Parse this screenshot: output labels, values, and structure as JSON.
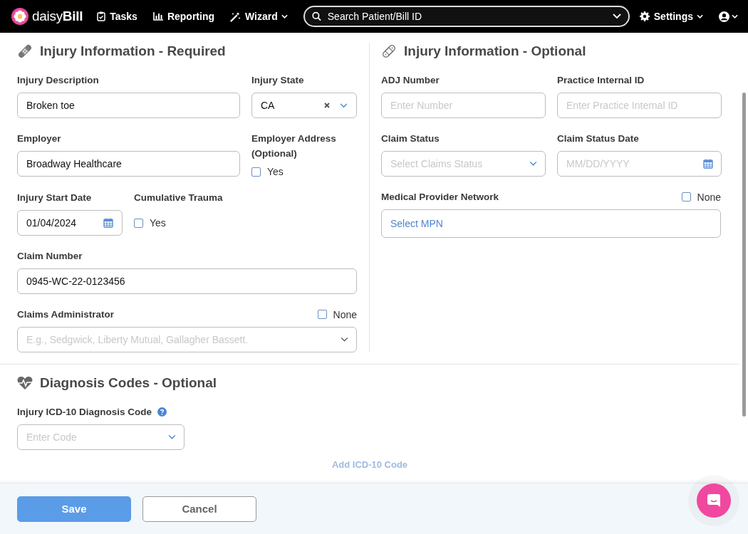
{
  "nav": {
    "logo": "daisy**Bill**",
    "items": [
      {
        "label": "Tasks",
        "kind": "clipboard",
        "dropdown": false
      },
      {
        "label": "Reporting",
        "kind": "chart",
        "dropdown": false
      },
      {
        "label": "Wizard",
        "kind": "wand",
        "dropdown": true
      }
    ],
    "search": {
      "placeholder": "Search Patient/Bill ID"
    },
    "settings": {
      "label": "Settings"
    }
  },
  "required": {
    "title": "Injury Information - Required",
    "injury_description": {
      "label": "Injury Description",
      "value": "Broken toe"
    },
    "injury_state": {
      "label": "Injury State",
      "value": "CA"
    },
    "employer": {
      "label": "Employer",
      "value": "Broadway Healthcare"
    },
    "employer_address": {
      "label": "Employer Address (Optional)",
      "option": "Yes",
      "checked": false
    },
    "injury_start_date": {
      "label": "Injury Start Date",
      "value": "01/04/2024"
    },
    "cumulative_trauma": {
      "label": "Cumulative Trauma",
      "option": "Yes",
      "checked": false
    },
    "claim_number": {
      "label": "Claim Number",
      "value": "0945-WC-22-0123456"
    },
    "claims_administrator": {
      "label": "Claims Administrator",
      "option": "None",
      "checked": false,
      "placeholder": "E.g., Sedgwick, Liberty Mutual, Gallagher Bassett."
    }
  },
  "optional": {
    "title": "Injury Information - Optional",
    "adj_number": {
      "label": "ADJ Number",
      "placeholder": "Enter Number"
    },
    "practice_internal_id": {
      "label": "Practice Internal ID",
      "placeholder": "Enter Practice Internal ID"
    },
    "claim_status": {
      "label": "Claim Status",
      "placeholder": "Select Claims Status"
    },
    "claim_status_date": {
      "label": "Claim Status Date",
      "placeholder": "MM/DD/YYYY"
    },
    "medical_provider_network": {
      "label": "Medical Provider Network",
      "option": "None",
      "checked": false,
      "placeholder": "Select MPN"
    }
  },
  "diagnosis": {
    "title": "Diagnosis Codes - Optional",
    "icd10": {
      "label": "Injury ICD-10 Diagnosis Code",
      "placeholder": "Enter Code"
    },
    "add_button": {
      "label": "Add ICD-10 Code",
      "disabled": true
    }
  },
  "footer": {
    "save": "Save",
    "cancel": "Cancel"
  }
}
